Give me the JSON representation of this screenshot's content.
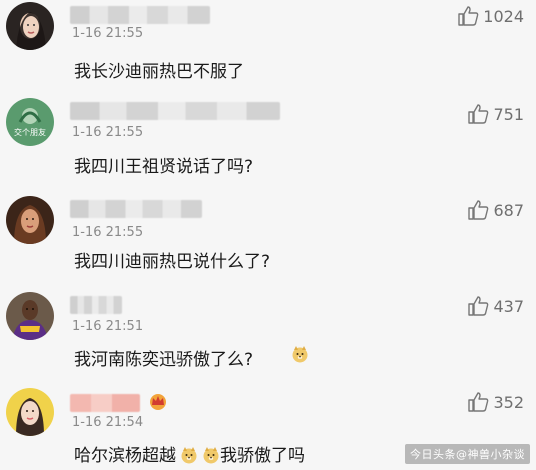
{
  "comments": [
    {
      "time": "1-16 21:55",
      "text": "我长沙迪丽热巴不服了",
      "likes": "1024",
      "avatar": "woman-dark-hair-avatar"
    },
    {
      "time": "1-16 21:55",
      "text": "我四川王祖贤说话了吗?",
      "likes": "751",
      "avatar": "green-badge-avatar",
      "avatar_label": "交个朋友"
    },
    {
      "time": "1-16 21:55",
      "text": "我四川迪丽热巴说什么了?",
      "likes": "687",
      "avatar": "woman-brown-hair-avatar"
    },
    {
      "time": "1-16 21:51",
      "text": "我河南陈奕迅骄傲了么?",
      "likes": "437",
      "avatar": "basketball-player-avatar"
    },
    {
      "time": "1-16 21:54",
      "text_before": "哈尔滨杨超越",
      "text_after": "我骄傲了吗",
      "likes": "352",
      "avatar": "girl-yellow-avatar"
    }
  ],
  "icons": {
    "like": "thumbs-up-icon",
    "doge": "doge-emoji-icon",
    "crown": "crown-badge-icon"
  },
  "watermark": "今日头条@神兽小杂谈"
}
